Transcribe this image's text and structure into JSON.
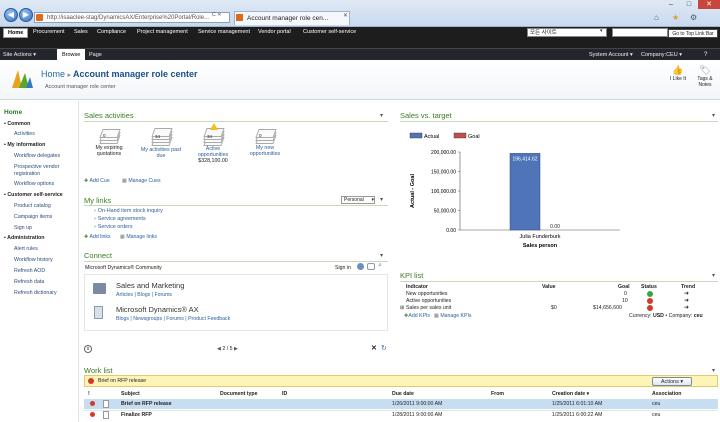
{
  "browser": {
    "address": "http://isaaclee-stag/DynamicsAX/Enterprise%20Portal/Role...",
    "tab_title": "Account manager role cen..."
  },
  "top_nav": {
    "items": [
      "Home",
      "Procurement",
      "Sales",
      "Compliance",
      "Project management",
      "Service management",
      "Vendor portal",
      "Customer self-service"
    ],
    "search_scope": "모든 사이트",
    "skip_link": "Go to Top Link Bar"
  },
  "ribbon": {
    "site_actions": "Site Actions ▾",
    "tabs": [
      "Browse",
      "Page"
    ],
    "system_account": "System Account ▾",
    "company": "Company:CEU ▾"
  },
  "title_area": {
    "breadcrumb_home": "Home",
    "page_title": "Account manager role center",
    "description": "Account manager role center",
    "i_like_it": "I Like It",
    "tags_notes": "Tags & Notes"
  },
  "left_nav": {
    "home": "Home",
    "sections": [
      {
        "label": "Common",
        "items": [
          "Activities"
        ]
      },
      {
        "label": "My information",
        "items": [
          "Workflow delegates",
          "Prospective vendor registration",
          "Workflow options"
        ]
      },
      {
        "label": "Customer self-service",
        "items": [
          "Product catalog",
          "Campaign items",
          "Sign up"
        ]
      },
      {
        "label": "Administration",
        "items": [
          "Alert rules",
          "Workflow history",
          "Refresh AOD",
          "Refresh data",
          "Refresh dictionary"
        ]
      }
    ]
  },
  "sales_activities": {
    "title": "Sales activities",
    "cues": [
      {
        "count": "0",
        "label": "My expiring quotations",
        "value": ""
      },
      {
        "count": "34",
        "label": "My activities past due",
        "value": ""
      },
      {
        "count": "34",
        "label": "Active opportunities",
        "value": "$328,100.00"
      },
      {
        "count": "0",
        "label": "My new opportunities",
        "value": ""
      }
    ],
    "add_cue": "Add Cue",
    "manage_cues": "Manage Cues"
  },
  "my_links": {
    "title": "My links",
    "dropdown": "Personal",
    "links": [
      "On-Hand item stock inquiry",
      "Service agreements",
      "Service orders"
    ],
    "add_links": "Add links",
    "manage_links": "Manage links"
  },
  "connect": {
    "title": "Connect",
    "community": "Microsoft Dynamics® Community",
    "sign_in": "Sign in",
    "items": [
      {
        "title": "Sales and Marketing",
        "links": "Articles | Blogs | Forums"
      },
      {
        "title": "Microsoft Dynamics® AX",
        "links": "Blogs | Newsgroups | Forums | Product Feedback"
      }
    ],
    "pager": "2 / 5"
  },
  "sales_vs_target": {
    "title": "Sales vs. target",
    "legend": [
      "Actual",
      "Goal"
    ]
  },
  "chart_data": {
    "type": "bar",
    "categories": [
      "Julia Funderburk"
    ],
    "series": [
      {
        "name": "Actual",
        "values": [
          196414.62
        ]
      },
      {
        "name": "Goal",
        "values": [
          0
        ]
      }
    ],
    "data_labels": [
      "196,414.62",
      "0.00"
    ],
    "title": "",
    "xlabel": "Sales person",
    "ylabel": "Actual - Goal",
    "ylim": [
      0,
      200000
    ],
    "yticks": [
      "200,000.00",
      "150,000.00",
      "100,000.00",
      "50,000.00",
      "0.00"
    ],
    "colors": {
      "Actual": "#4f74b8",
      "Goal": "#c0504d"
    }
  },
  "kpi_list": {
    "title": "KPI list",
    "headers": [
      "Indicator",
      "Value",
      "Goal",
      "Status",
      "Trend"
    ],
    "rows": [
      {
        "indicator": "New opportunities",
        "value": "",
        "goal": "0",
        "status": "green"
      },
      {
        "indicator": "Active opportunities",
        "value": "",
        "goal": "10",
        "status": "red"
      },
      {
        "indicator": "Sales per sales unit",
        "value": "$0",
        "goal": "$14,656,600",
        "status": "red"
      }
    ],
    "add_kpis": "Add KPIs",
    "manage_kpis": "Manage KPIs",
    "currency_label": "Currency:",
    "currency": "USD",
    "company_label": "Company:",
    "company": "ceu"
  },
  "work_list": {
    "title": "Work list",
    "selected_item": "Brief on RFP release",
    "actions": "Actions ▾",
    "headers": [
      "!",
      "Subject",
      "Document type",
      "ID",
      "Due date",
      "From",
      "Creation date ▾",
      "Association"
    ],
    "rows": [
      {
        "subject": "Brief on RFP release",
        "due": "1/26/2011 9:00:00 AM",
        "created": "1/25/2011 6:01:10 AM",
        "assoc": "ceu"
      },
      {
        "subject": "Finalize RFP",
        "due": "1/28/2011 9:00:00 AM",
        "created": "1/25/2011 6:00:22 AM",
        "assoc": "ceu"
      }
    ]
  }
}
